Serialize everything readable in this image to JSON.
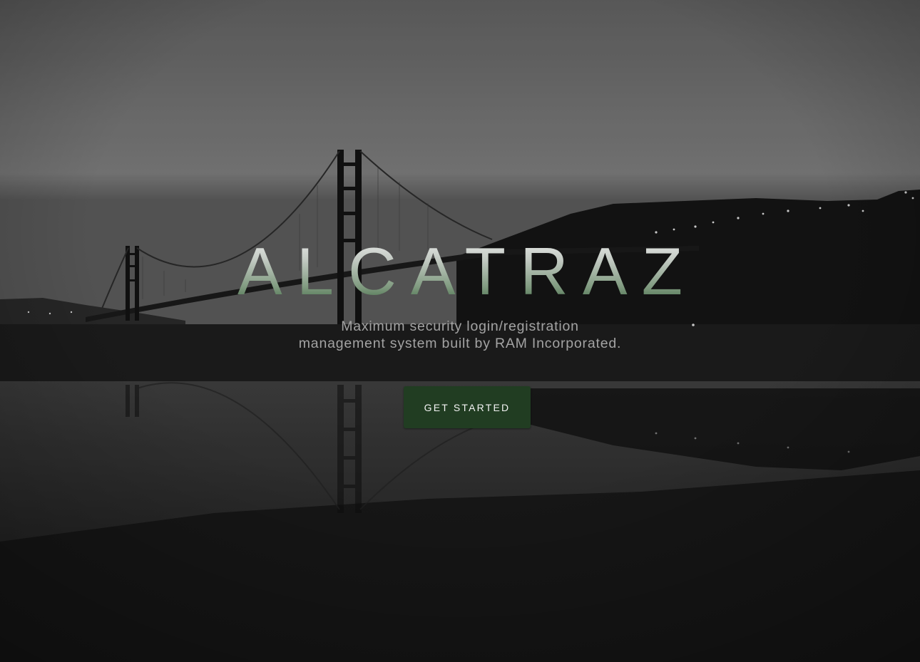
{
  "hero": {
    "title": "ALCATRAZ",
    "subtitle_line1": "Maximum security login/registration",
    "subtitle_line2": "management system built by RAM Incorporated.",
    "cta_label": "GET STARTED"
  },
  "colors": {
    "background": "#171717",
    "button": "#213d22",
    "title_gradient_top": "#f2f2f2",
    "title_gradient_bottom": "#2f5a33",
    "subtitle": "#a3a3a3"
  }
}
